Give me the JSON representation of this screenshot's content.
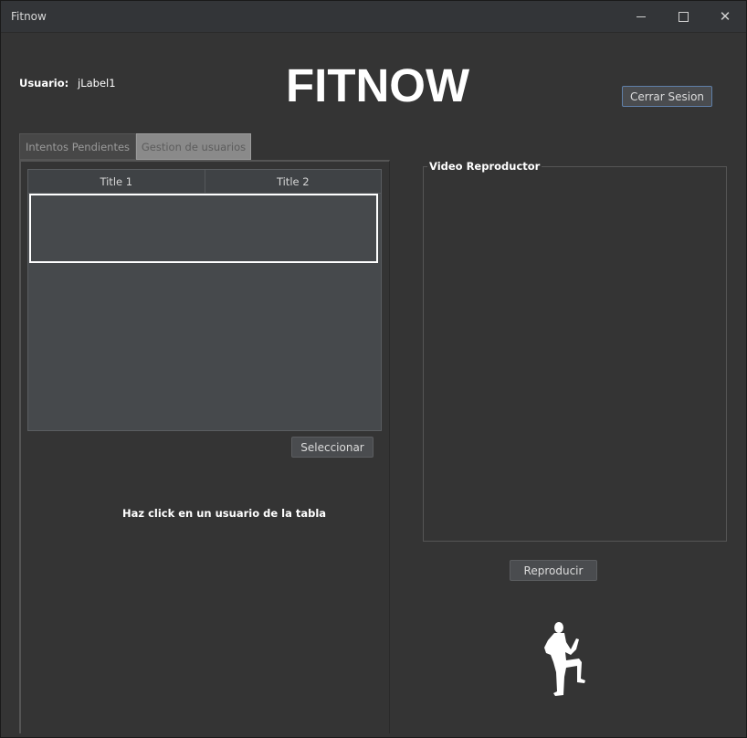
{
  "window": {
    "title": "Fitnow",
    "controls": [
      "minimize-icon",
      "maximize-icon",
      "close-icon"
    ]
  },
  "header": {
    "usuario_label": "Usuario:",
    "usuario_value": "jLabel1",
    "app_title": "FITNOW",
    "logout_label": "Cerrar Sesion"
  },
  "tabs": [
    {
      "label": "Intentos Pendientes"
    },
    {
      "label": "Gestion de usuarios"
    }
  ],
  "table": {
    "columns": [
      "Title 1",
      "Title 2"
    ],
    "rows": []
  },
  "left_panel": {
    "select_label": "Seleccionar",
    "hint_text": "Haz click en un usuario de la tabla"
  },
  "video": {
    "group_title": "Video Reproductor",
    "play_label": "Reproducir",
    "figure_icon": "exercising-person-icon"
  },
  "colors": {
    "background": "#343434",
    "titlebar": "#333538",
    "button": "#4a4c4f",
    "table_bg": "#46494c",
    "accent_border": "#5f7fa8"
  }
}
